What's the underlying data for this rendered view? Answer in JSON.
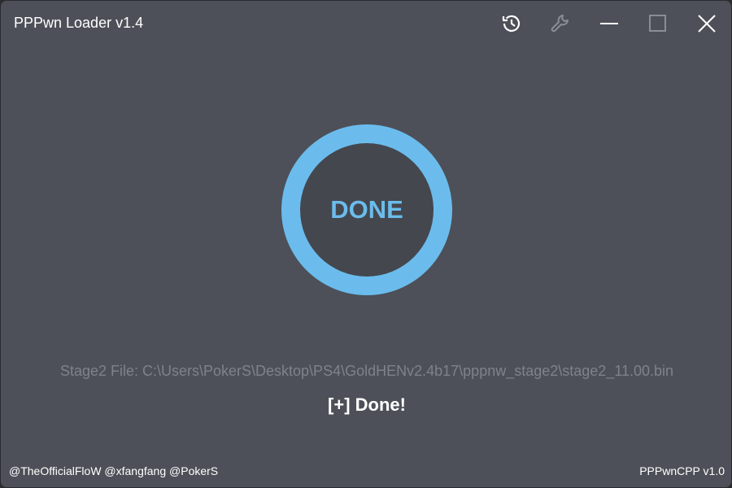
{
  "window": {
    "title": "PPPwn Loader v1.4"
  },
  "toolbar": {
    "icons": [
      "history-icon",
      "wrench-icon",
      "minimize-icon",
      "maximize-icon",
      "close-icon"
    ]
  },
  "status_circle": {
    "label": "DONE",
    "ring_color": "#6bbcec"
  },
  "stage2_file": "Stage2 File: C:\\Users\\PokerS\\Desktop\\PS4\\GoldHENv2.4b17\\pppnw_stage2\\stage2_11.00.bin",
  "status_message": "[+] Done!",
  "footer": {
    "credits": "@TheOfficialFloW @xfangfang @PokerS",
    "version": "PPPwnCPP v1.0"
  }
}
